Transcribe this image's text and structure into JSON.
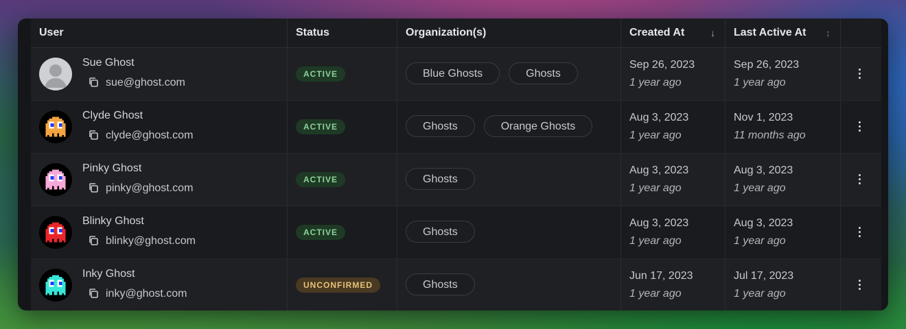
{
  "table": {
    "headers": {
      "user": "User",
      "status": "Status",
      "organizations": "Organization(s)",
      "created_at": "Created At",
      "last_active_at": "Last Active At"
    },
    "sort": {
      "created_at": "arrow-down-icon",
      "last_active_at": "sort-updown-icon"
    },
    "rows": [
      {
        "name": "Sue Ghost",
        "email": "sue@ghost.com",
        "avatar": "default-avatar",
        "status": "ACTIVE",
        "orgs": [
          "Blue Ghosts",
          "Ghosts"
        ],
        "created": "Sep 26, 2023",
        "created_rel": "1 year ago",
        "last_active": "Sep 26, 2023",
        "last_active_rel": "1 year ago"
      },
      {
        "name": "Clyde Ghost",
        "email": "clyde@ghost.com",
        "avatar": "orange-ghost",
        "avatar_color": "#f5a442",
        "status": "ACTIVE",
        "orgs": [
          "Ghosts",
          "Orange Ghosts"
        ],
        "created": "Aug 3, 2023",
        "created_rel": "1 year ago",
        "last_active": "Nov 1, 2023",
        "last_active_rel": "11 months ago"
      },
      {
        "name": "Pinky Ghost",
        "email": "pinky@ghost.com",
        "avatar": "pink-ghost",
        "avatar_color": "#f7a8d8",
        "status": "ACTIVE",
        "orgs": [
          "Ghosts"
        ],
        "created": "Aug 3, 2023",
        "created_rel": "1 year ago",
        "last_active": "Aug 3, 2023",
        "last_active_rel": "1 year ago"
      },
      {
        "name": "Blinky Ghost",
        "email": "blinky@ghost.com",
        "avatar": "red-ghost",
        "avatar_color": "#e8262a",
        "status": "ACTIVE",
        "orgs": [
          "Ghosts"
        ],
        "created": "Aug 3, 2023",
        "created_rel": "1 year ago",
        "last_active": "Aug 3, 2023",
        "last_active_rel": "1 year ago"
      },
      {
        "name": "Inky Ghost",
        "email": "inky@ghost.com",
        "avatar": "cyan-ghost",
        "avatar_color": "#36e6d8",
        "status": "UNCONFIRMED",
        "orgs": [
          "Ghosts"
        ],
        "created": "Jun 17, 2023",
        "created_rel": "1 year ago",
        "last_active": "Jul 17, 2023",
        "last_active_rel": "1 year ago"
      }
    ]
  }
}
